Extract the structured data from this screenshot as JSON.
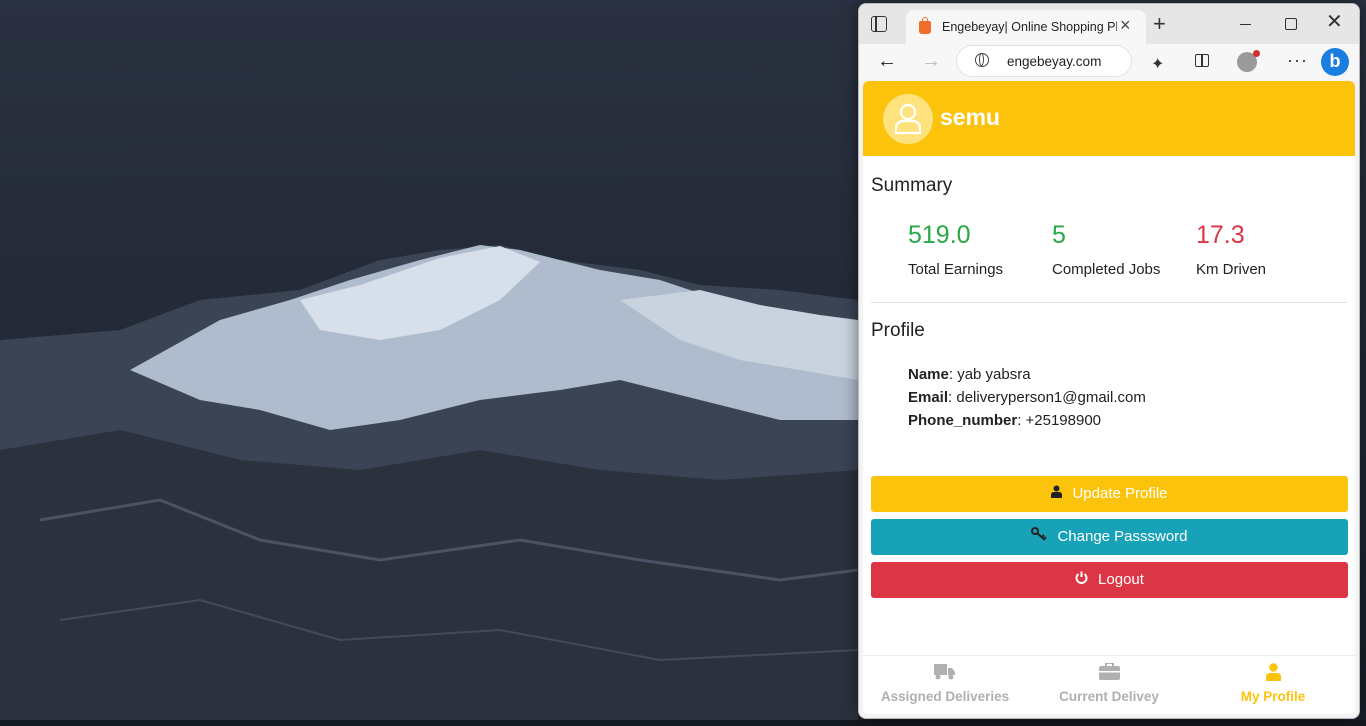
{
  "browser": {
    "tab_title": "Engebeyay| Online Shopping Platform",
    "url": "engebeyay.com",
    "new_tab": "+",
    "close_tab": "×",
    "window_close": "✕",
    "more": "···",
    "bing": "b"
  },
  "header": {
    "username": "semu"
  },
  "summary": {
    "title": "Summary",
    "stats": [
      {
        "value": "519.0",
        "label": "Total Earnings",
        "color": "#28a745"
      },
      {
        "value": "5",
        "label": "Completed Jobs",
        "color": "#28a745"
      },
      {
        "value": "17.3",
        "label": "Km Driven",
        "color": "#dc3545"
      }
    ]
  },
  "profile": {
    "title": "Profile",
    "name_label": "Name",
    "name_value": ": yab yabsra",
    "email_label": "Email",
    "email_value": ": deliveryperson1@gmail.com",
    "phone_label": "Phone_number",
    "phone_value": ": +25198900"
  },
  "actions": {
    "update_label": "Update Profile",
    "change_password_label": "Change Passsword",
    "logout_label": "Logout"
  },
  "bottom_nav": {
    "items": [
      {
        "label": "Assigned Deliveries",
        "icon": "truck-icon",
        "active": false
      },
      {
        "label": "Current Delivey",
        "icon": "briefcase-icon",
        "active": false
      },
      {
        "label": "My Profile",
        "icon": "user-icon",
        "active": true
      }
    ],
    "active_color": "#fcc30d",
    "inactive_color": "#b0b0b0"
  }
}
